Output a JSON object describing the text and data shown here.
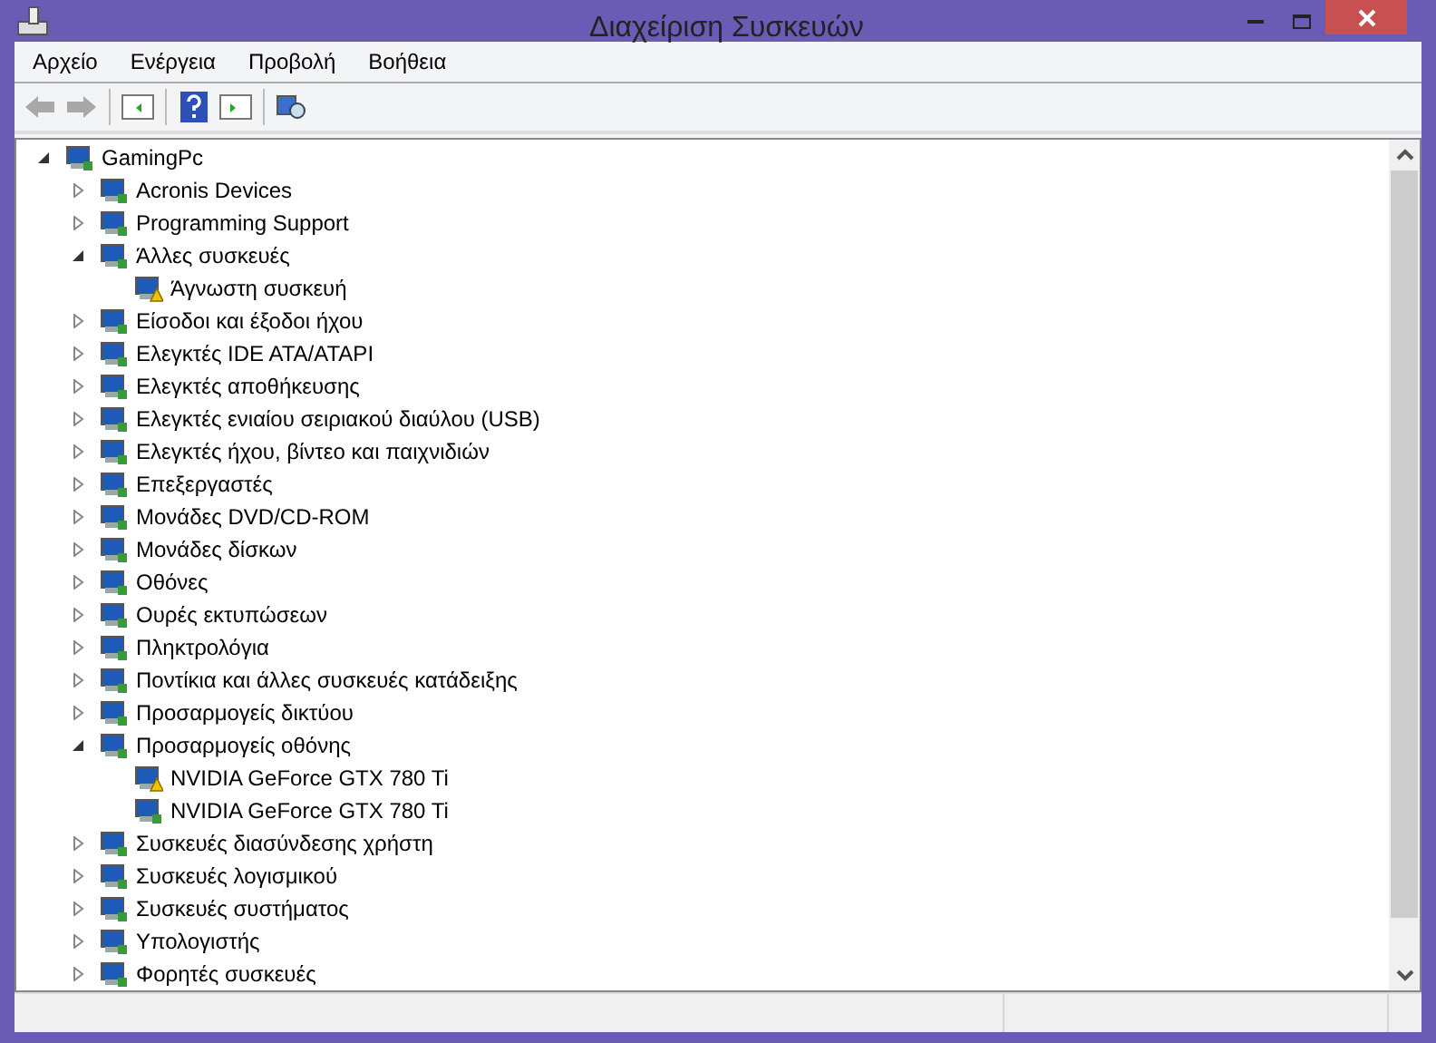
{
  "window": {
    "title": "Διαχείριση Συσκευών"
  },
  "menu": [
    "Αρχείο",
    "Ενέργεια",
    "Προβολή",
    "Βοήθεια"
  ],
  "tree": {
    "label": "GamingPc",
    "expanded": true,
    "children": [
      {
        "label": "Acronis Devices",
        "expanded": false
      },
      {
        "label": "Programming Support",
        "expanded": false
      },
      {
        "label": "Άλλες συσκευές",
        "expanded": true,
        "children": [
          {
            "label": "Άγνωστη συσκευή",
            "warning": true
          }
        ]
      },
      {
        "label": "Είσοδοι και έξοδοι ήχου",
        "expanded": false
      },
      {
        "label": "Ελεγκτές IDE ATA/ATAPI",
        "expanded": false
      },
      {
        "label": "Ελεγκτές αποθήκευσης",
        "expanded": false
      },
      {
        "label": "Ελεγκτές ενιαίου σειριακού διαύλου (USB)",
        "expanded": false
      },
      {
        "label": "Ελεγκτές ήχου, βίντεο και παιχνιδιών",
        "expanded": false
      },
      {
        "label": "Επεξεργαστές",
        "expanded": false
      },
      {
        "label": "Μονάδες DVD/CD-ROM",
        "expanded": false
      },
      {
        "label": "Μονάδες δίσκων",
        "expanded": false
      },
      {
        "label": "Οθόνες",
        "expanded": false
      },
      {
        "label": "Ουρές εκτυπώσεων",
        "expanded": false
      },
      {
        "label": "Πληκτρολόγια",
        "expanded": false
      },
      {
        "label": "Ποντίκια και άλλες συσκευές κατάδειξης",
        "expanded": false
      },
      {
        "label": "Προσαρμογείς δικτύου",
        "expanded": false
      },
      {
        "label": "Προσαρμογείς οθόνης",
        "expanded": true,
        "children": [
          {
            "label": "NVIDIA GeForce GTX 780 Ti",
            "warning": true
          },
          {
            "label": "NVIDIA GeForce GTX 780 Ti",
            "warning": false
          }
        ]
      },
      {
        "label": "Συσκευές διασύνδεσης χρήστη",
        "expanded": false
      },
      {
        "label": "Συσκευές λογισμικού",
        "expanded": false
      },
      {
        "label": "Συσκευές συστήματος",
        "expanded": false
      },
      {
        "label": "Υπολογιστής",
        "expanded": false
      },
      {
        "label": "Φορητές συσκευές",
        "expanded": false
      }
    ]
  }
}
